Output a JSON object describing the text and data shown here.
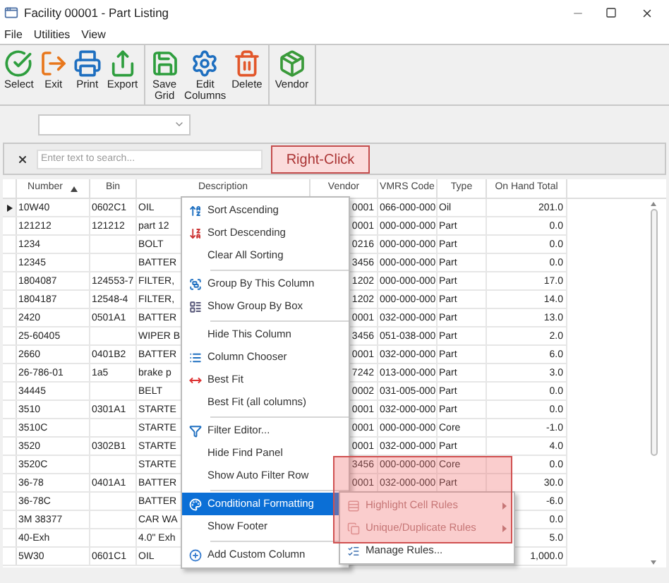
{
  "window": {
    "title": "Facility 00001 - Part Listing"
  },
  "menu_bar": [
    "File",
    "Utilities",
    "View"
  ],
  "toolbar": [
    [
      {
        "lines": [
          "Select"
        ]
      },
      {
        "lines": [
          "Exit"
        ]
      },
      {
        "lines": [
          "Print"
        ]
      },
      {
        "lines": [
          "Export"
        ]
      }
    ],
    [
      {
        "lines": [
          "Save",
          "Grid"
        ]
      },
      {
        "lines": [
          "Edit",
          "Columns"
        ]
      },
      {
        "lines": [
          "Delete"
        ]
      }
    ],
    [
      {
        "lines": [
          "Vendor"
        ]
      }
    ]
  ],
  "search": {
    "placeholder": "Enter text to search..."
  },
  "annotation": {
    "text": "Right-Click"
  },
  "grid": {
    "columns": [
      {
        "label": "Number",
        "sorted": true
      },
      {
        "label": "Bin",
        "sorted": false
      },
      {
        "label": "Description",
        "sorted": false
      },
      {
        "label": "Vendor",
        "sorted": false
      },
      {
        "label": "VMRS Code",
        "sorted": false
      },
      {
        "label": "Type",
        "sorted": false
      },
      {
        "label": "On Hand Total",
        "sorted": false
      }
    ],
    "rows": [
      {
        "selected": true,
        "cells": [
          "10W40",
          "0602C1",
          "OIL",
          "0001",
          "066-000-000",
          "Oil",
          "201.0"
        ]
      },
      {
        "selected": false,
        "cells": [
          "121212",
          "121212",
          "part 12",
          "0001",
          "000-000-000",
          "Part",
          "0.0"
        ]
      },
      {
        "selected": false,
        "cells": [
          "1234",
          null,
          "BOLT",
          "0216",
          "000-000-000",
          "Part",
          "0.0"
        ]
      },
      {
        "selected": false,
        "cells": [
          "12345",
          null,
          "BATTER",
          "3456",
          "000-000-000",
          "Part",
          "0.0"
        ]
      },
      {
        "selected": false,
        "cells": [
          "1804087",
          "124553-7",
          "FILTER,",
          "1202",
          "000-000-000",
          "Part",
          "17.0"
        ]
      },
      {
        "selected": false,
        "cells": [
          "1804187",
          "12548-4",
          "FILTER,",
          "1202",
          "000-000-000",
          "Part",
          "14.0"
        ]
      },
      {
        "selected": false,
        "cells": [
          "2420",
          "0501A1",
          "BATTER",
          "0001",
          "032-000-000",
          "Part",
          "13.0"
        ]
      },
      {
        "selected": false,
        "cells": [
          "25-60405",
          null,
          "WIPER B",
          "3456",
          "051-038-000",
          "Part",
          "2.0"
        ]
      },
      {
        "selected": false,
        "cells": [
          "2660",
          "0401B2",
          "BATTER",
          "0001",
          "032-000-000",
          "Part",
          "6.0"
        ]
      },
      {
        "selected": false,
        "cells": [
          "26-786-01",
          "1a5",
          "brake p",
          "7242",
          "013-000-000",
          "Part",
          "3.0"
        ]
      },
      {
        "selected": false,
        "cells": [
          "34445",
          null,
          "BELT",
          "0002",
          "031-005-000",
          "Part",
          "0.0"
        ]
      },
      {
        "selected": false,
        "cells": [
          "3510",
          "0301A1",
          "STARTE",
          "0001",
          "032-000-000",
          "Part",
          "0.0"
        ]
      },
      {
        "selected": false,
        "cells": [
          "3510C",
          null,
          "STARTE",
          "0001",
          "000-000-000",
          "Core",
          "-1.0"
        ]
      },
      {
        "selected": false,
        "cells": [
          "3520",
          "0302B1",
          "STARTE",
          "0001",
          "032-000-000",
          "Part",
          "4.0"
        ]
      },
      {
        "selected": false,
        "cells": [
          "3520C",
          null,
          "STARTE",
          "3456",
          "000-000-000",
          "Core",
          "0.0"
        ]
      },
      {
        "selected": false,
        "cells": [
          "36-78",
          "0401A1",
          "BATTER",
          "0001",
          "032-000-000",
          "Part",
          "30.0"
        ]
      },
      {
        "selected": false,
        "cells": [
          "36-78C",
          null,
          "BATTER",
          null,
          null,
          null,
          "-6.0"
        ]
      },
      {
        "selected": false,
        "cells": [
          "3M 38377",
          null,
          "CAR WA",
          null,
          null,
          null,
          "0.0"
        ]
      },
      {
        "selected": false,
        "cells": [
          "40-Exh",
          null,
          "4.0\" Exh",
          null,
          null,
          null,
          "5.0"
        ]
      },
      {
        "selected": false,
        "cells": [
          "5W30",
          "0601C1",
          "OIL",
          null,
          null,
          null,
          "1,000.0"
        ]
      }
    ]
  },
  "context_menu": {
    "items": [
      {
        "kind": "item",
        "label": "Sort Ascending",
        "selected": false
      },
      {
        "kind": "item",
        "label": "Sort Descending",
        "selected": false
      },
      {
        "kind": "item",
        "label": "Clear All Sorting",
        "selected": false
      },
      {
        "kind": "separator"
      },
      {
        "kind": "item",
        "label": "Group By This Column",
        "selected": false
      },
      {
        "kind": "item",
        "label": "Show Group By Box",
        "selected": false
      },
      {
        "kind": "separator"
      },
      {
        "kind": "item",
        "label": "Hide This Column",
        "selected": false
      },
      {
        "kind": "item",
        "label": "Column Chooser",
        "selected": false
      },
      {
        "kind": "item",
        "label": "Best Fit",
        "selected": false
      },
      {
        "kind": "item",
        "label": "Best Fit (all columns)",
        "selected": false
      },
      {
        "kind": "separator"
      },
      {
        "kind": "item",
        "label": "Filter Editor...",
        "selected": false
      },
      {
        "kind": "item",
        "label": "Hide Find Panel",
        "selected": false
      },
      {
        "kind": "item",
        "label": "Show Auto Filter Row",
        "selected": false
      },
      {
        "kind": "separator"
      },
      {
        "kind": "item",
        "label": "Conditional Formatting",
        "selected": true
      },
      {
        "kind": "item",
        "label": "Show Footer",
        "selected": false
      },
      {
        "kind": "separator"
      },
      {
        "kind": "item",
        "label": "Add Custom Column",
        "selected": false
      }
    ]
  },
  "submenu": {
    "items": [
      {
        "label": "Highlight Cell Rules",
        "disabled": true,
        "submenu": true
      },
      {
        "label": "Unique/Duplicate Rules",
        "disabled": true,
        "submenu": true
      },
      {
        "label": "Manage Rules...",
        "disabled": false,
        "submenu": false
      }
    ]
  }
}
